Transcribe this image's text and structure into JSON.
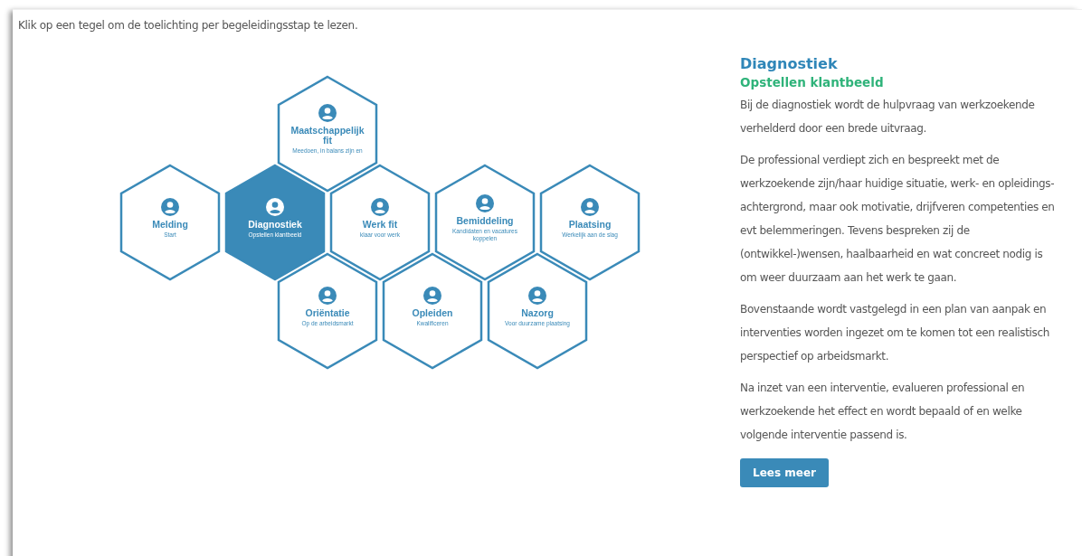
{
  "intro": "Klik op een tegel om de toelichting per begeleidingsstap te lezen.",
  "tile_rows": [
    {
      "tiles": [
        {
          "title": "Maatschappelijk fit",
          "subtitle": "Meedoen, in balans zijn en",
          "selected": false
        }
      ]
    },
    {
      "tiles": [
        {
          "title": "Melding",
          "subtitle": "Start",
          "selected": false
        },
        {
          "title": "Diagnostiek",
          "subtitle": "Opstellen klantbeeld",
          "selected": true
        },
        {
          "title": "Werk fit",
          "subtitle": "klaar voor werk",
          "selected": false
        },
        {
          "title": "Bemiddeling",
          "subtitle": "Kandidaten en vacatures koppelen",
          "selected": false
        },
        {
          "title": "Plaatsing",
          "subtitle": "Werkelijk aan de slag",
          "selected": false
        }
      ]
    },
    {
      "tiles": [
        {
          "title": "Oriëntatie",
          "subtitle": "Op de arbeidsmarkt",
          "selected": false
        },
        {
          "title": "Opleiden",
          "subtitle": "Kwalificeren",
          "selected": false
        },
        {
          "title": "Nazorg",
          "subtitle": "Voor duurzame plaatsing",
          "selected": false
        }
      ]
    }
  ],
  "detail": {
    "title": "Diagnostiek",
    "subtitle": "Opstellen klantbeeld",
    "paragraphs": [
      "Bij de diagnostiek wordt de hulpvraag van werkzoekende verhelderd door een brede uitvraag.",
      "De professional verdiept zich en bespreekt met de werkzoekende zijn/haar huidige situatie, werk- en opleidings-achtergrond, maar ook motivatie, drijfveren competenties en evt belemmeringen. Tevens bespreken zij de (ontwikkel-)wensen, haalbaarheid en wat concreet nodig is om weer duurzaam aan het werk te gaan.",
      "Bovenstaande wordt vastgelegd in een plan van aanpak en interventies worden ingezet om te komen tot een realistisch perspectief op arbeidsmarkt.",
      "Na inzet van een interventie, evalueren professional en werkzoekende het effect en wordt bepaald of en welke volgende interventie passend is."
    ],
    "button": "Lees meer"
  }
}
